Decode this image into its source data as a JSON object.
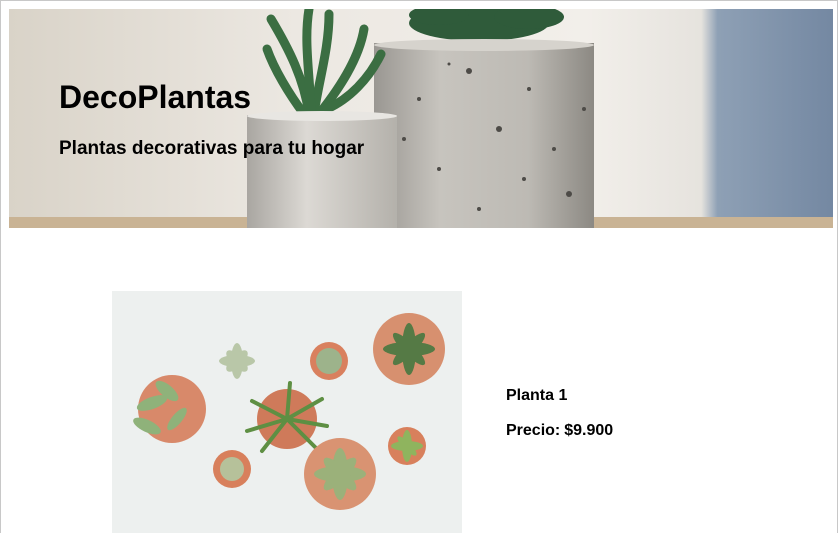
{
  "header": {
    "title": "DecoPlantas",
    "subtitle": "Plantas decorativas para tu hogar",
    "image": "hero-concrete-pots-cactus-photo"
  },
  "products": [
    {
      "name": "Planta 1",
      "price_label": "Precio:",
      "price": "$9.900",
      "image": "succulents-top-view-photo"
    }
  ],
  "colors": {
    "text": "#000000",
    "background": "#ffffff",
    "hero_wall": "#e9e4dc",
    "hero_blue": "#7d93ab",
    "pot_concrete": "#b9b6b1",
    "plant_green": "#3d7a4a",
    "terracotta": "#d8896a",
    "product_bg": "#edf0ef"
  }
}
